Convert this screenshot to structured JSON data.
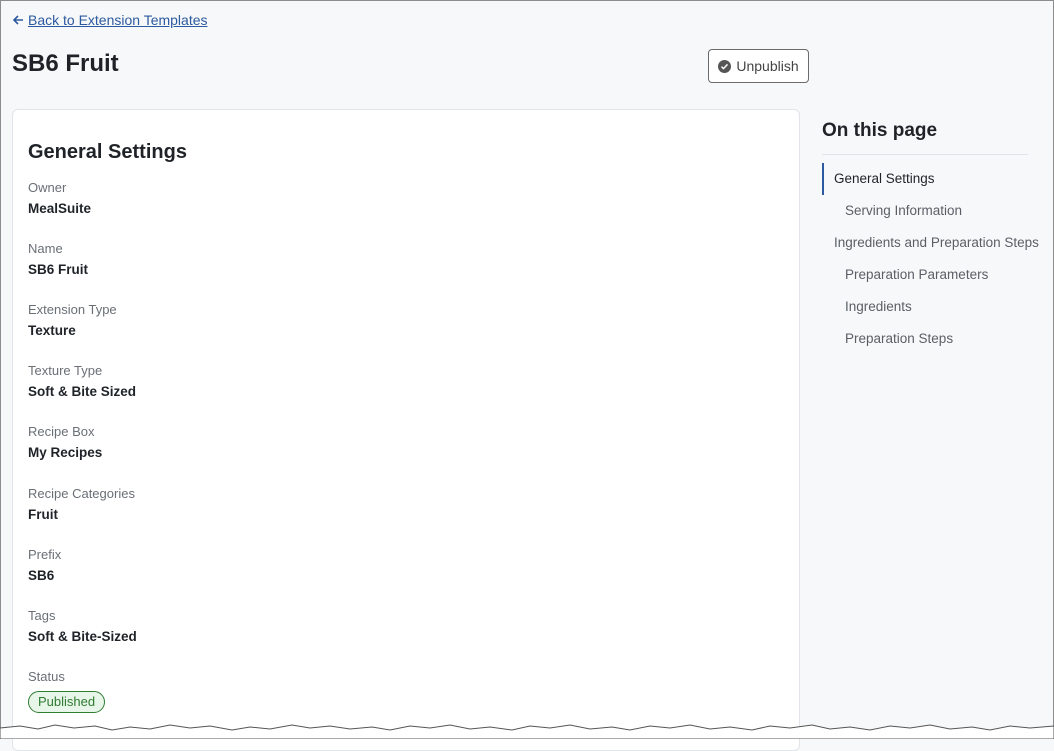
{
  "back_link": {
    "label": "Back to Extension Templates",
    "icon": "arrow-left-icon"
  },
  "page_title": "SB6 Fruit",
  "unpublish_button": {
    "label": "Unpublish",
    "icon": "check-circle-icon"
  },
  "general_settings": {
    "heading": "General Settings",
    "fields": [
      {
        "label": "Owner",
        "value": "MealSuite"
      },
      {
        "label": "Name",
        "value": "SB6 Fruit"
      },
      {
        "label": "Extension Type",
        "value": "Texture"
      },
      {
        "label": "Texture Type",
        "value": "Soft & Bite Sized"
      },
      {
        "label": "Recipe Box",
        "value": "My Recipes"
      },
      {
        "label": "Recipe Categories",
        "value": "Fruit"
      },
      {
        "label": "Prefix",
        "value": "SB6"
      },
      {
        "label": "Tags",
        "value": "Soft & Bite-Sized"
      }
    ],
    "status": {
      "label": "Status",
      "value": "Published",
      "color": "#2e7d32"
    }
  },
  "toc": {
    "title": "On this page",
    "items": [
      {
        "label": "General Settings",
        "active": true
      },
      {
        "label": "Serving Information"
      },
      {
        "label": "Ingredients and Preparation Steps"
      },
      {
        "label": "Preparation Parameters"
      },
      {
        "label": "Ingredients"
      },
      {
        "label": "Preparation Steps"
      }
    ]
  },
  "colors": {
    "accent": "#2c5aa0",
    "status_green": "#2e7d32"
  }
}
